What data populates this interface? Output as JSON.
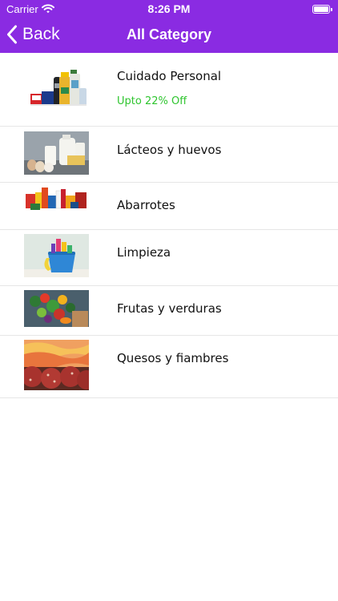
{
  "status_bar": {
    "carrier": "Carrier",
    "time": "8:26 PM"
  },
  "nav": {
    "back_label": "Back",
    "title": "All Category"
  },
  "categories": [
    {
      "name": "Cuidado Personal",
      "offer": "Upto 22% Off",
      "image": "personal-care-products"
    },
    {
      "name": "Lácteos y huevos",
      "image": "dairy-and-eggs"
    },
    {
      "name": "Abarrotes",
      "image": "groceries"
    },
    {
      "name": "Limpieza",
      "image": "cleaning-supplies"
    },
    {
      "name": "Frutas y verduras",
      "image": "fruits-and-vegetables"
    },
    {
      "name": "Quesos y fiambres",
      "image": "cheese-and-cold-cuts"
    }
  ],
  "colors": {
    "header": "#8a2be2",
    "offer": "#2fc52f"
  }
}
